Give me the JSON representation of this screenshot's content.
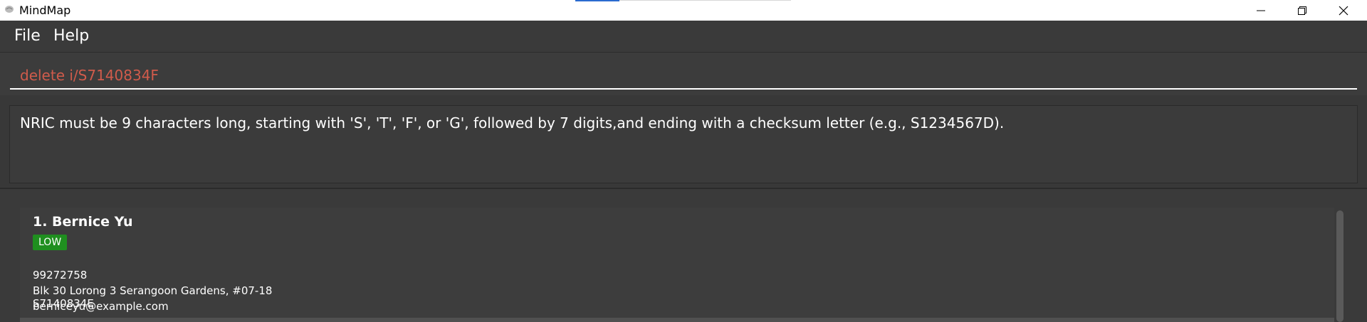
{
  "window": {
    "title": "MindMap"
  },
  "menu": {
    "file": "File",
    "help": "Help"
  },
  "command": {
    "value": "delete i/S7140834F"
  },
  "result": {
    "message": "NRIC must be 9 characters long, starting with 'S', 'T', 'F', or 'G', followed by 7 digits,and ending with a checksum letter (e.g., S1234567D)."
  },
  "persons": [
    {
      "index_name": "1. Bernice Yu",
      "priority": "LOW",
      "phone": "99272758",
      "address": "Blk 30 Lorong 3 Serangoon Gardens, #07-18",
      "email": "berniceyu@example.com",
      "nric": "S7140834E"
    }
  ],
  "colors": {
    "error_text": "#d05b4b",
    "priority_low": "#1f8f1f",
    "background": "#3c3c3c"
  }
}
